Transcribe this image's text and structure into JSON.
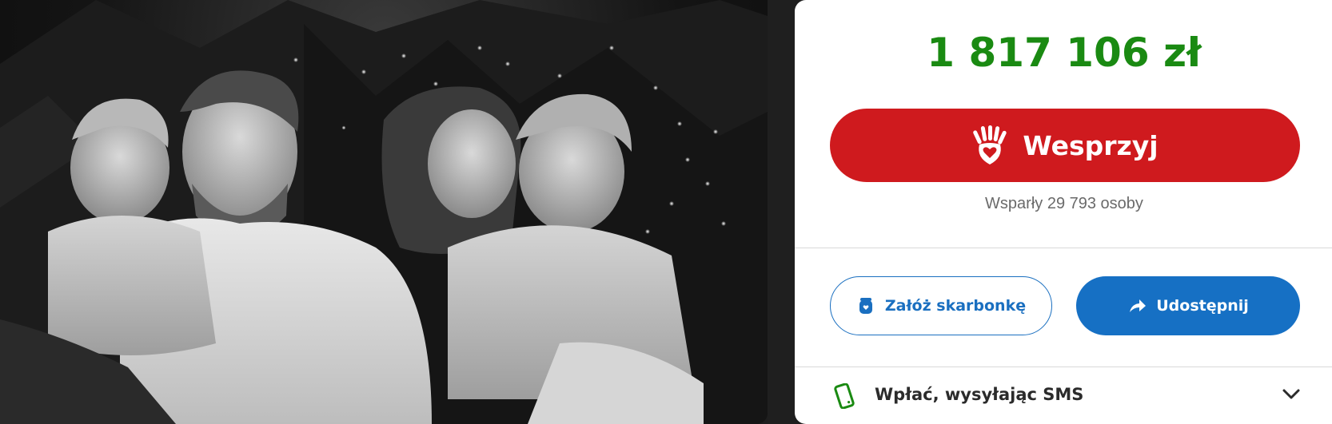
{
  "campaign": {
    "amount": "1 817 106 zł",
    "support_button_label": "Wesprzyj",
    "supporters_text": "Wsparły 29 793 osoby",
    "piggybank_button_label": "Załóż skarbonkę",
    "share_button_label": "Udostępnij",
    "sms_label": "Wpłać, wysyłając SMS"
  },
  "icons": {
    "support": "heart-hand-icon",
    "piggybank": "piggybank-icon",
    "share": "share-arrow-icon",
    "sms": "phone-icon",
    "expand": "chevron-down-icon"
  },
  "colors": {
    "amount": "#1a8a12",
    "support_button": "#cf1a1e",
    "primary_blue": "#1670c4"
  }
}
